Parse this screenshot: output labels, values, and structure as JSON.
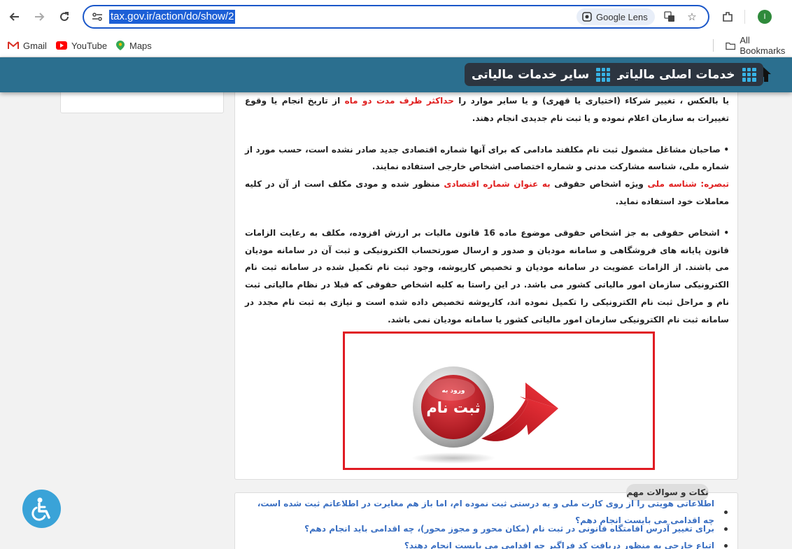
{
  "browser": {
    "url": "tax.gov.ir/action/do/show/2",
    "lens_label": "Google Lens",
    "profile_initial": "I",
    "bookmarks": [
      {
        "label": "Gmail"
      },
      {
        "label": "YouTube"
      },
      {
        "label": "Maps"
      }
    ],
    "all_bookmarks_label": "All Bookmarks"
  },
  "header": {
    "nav_main": "خدمات اصلی مالیاتی",
    "nav_other": "سایر خدمات مالیاتی"
  },
  "content": {
    "p1_a": "یا بالعکس ، تغییر شرکاء (اختیاری یا قهری) و یا سایر موارد را ",
    "p1_red": "حداکثر ظرف مدت دو ماه",
    "p1_b": " از تاریخ انجام یا وقوع تغییرات به سازمان اعلام نموده و یا ثبت نام جدیدی انجام دهند.",
    "p2": "• صاحبان مشاغل مشمول ثبت نام مکلفند مادامی که برای آنها شماره اقتصادی جدید صادر نشده است، حسب مورد از شماره ملی، شناسه مشارکت مدنی و شماره اختصاصی اشخاص خارجی استفاده نمایند.",
    "note_label": "تبصره: ",
    "note_red1": "شناسه ملی",
    "note_mid": " ویژه اشخاص حقوقی ",
    "note_red2": "به عنوان شماره اقتصادی",
    "note_end": " منظور شده و مودی مکلف است از آن در کلیه معاملات خود استفاده نماید.",
    "p3": "• اشخاص حقوقی به جز اشخاص حقوقی موضوع ماده 16 قانون مالیات بر ارزش افزوده، مکلف به رعایت الزامات قانون پایانه های فروشگاهی و سامانه مودیان و صدور و ارسال صورتحساب الکترونیکی و ثبت آن در سامانه مودیان می باشند. از الزامات عضویت در سامانه مودیان و تخصیص کارپوشه، وجود ثبت نام تکمیل شده در سامانه ثبت نام الکترونیکی سازمان امور مالیاتی کشور می باشد. در این راستا به کلیه اشخاص حقوقی که قبلا در نظام مالیاتی ثبت نام و مراحل ثبت نام الکترونیکی را تکمیل نموده اند، کارپوشه تخصیص داده شده است و نیازی به ثبت نام مجدد در سامانه ثبت نام الکترونیکی سازمان امور مالیاتی کشور یا سامانه مودیان نمی باشد."
  },
  "register_button": {
    "top_text": "ورود به",
    "main_text": "ثبت نام"
  },
  "faq": {
    "title": "نکات و سوالات مهم",
    "items": [
      "اطلاعاتی هویتی را از روی کارت ملی و به درستی ثبت نموده ام، اما باز هم مغایرت در اطلاعاتم ثبت شده است، چه اقدامی می بایست انجام دهم؟",
      "برای تغییر آدرس اقامتگاه قانونی در ثبت نام (مکان محور و مجوز محور)، چه اقدامی باید انجام دهم؟",
      "اتباع خارجی به منظور دریافت کد فراگیر چه اقدامی می بایست انجام دهند؟"
    ]
  },
  "colors": {
    "header_bg": "#2b6f8f",
    "nav_bg": "#2c3540",
    "accent_red": "#e01b23",
    "link_blue": "#3a6fc2"
  }
}
